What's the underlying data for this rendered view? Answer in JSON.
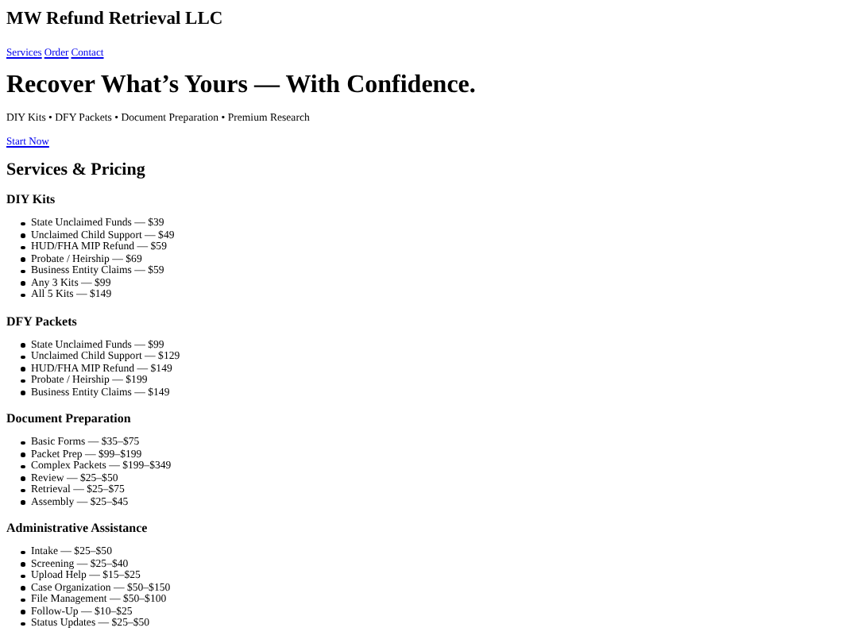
{
  "site_title": "MW Refund Retrieval LLC",
  "nav": [
    {
      "label": "Services"
    },
    {
      "label": "Order"
    },
    {
      "label": "Contact"
    }
  ],
  "hero": {
    "heading": "Recover What’s Yours — With Confidence.",
    "tagline": "DIY Kits • DFY Packets • Document Preparation • Premium Research",
    "cta": "Start Now"
  },
  "services": {
    "heading": "Services & Pricing",
    "sections": [
      {
        "title": "DIY Kits",
        "items": [
          "State Unclaimed Funds — $39",
          "Unclaimed Child Support — $49",
          "HUD/FHA MIP Refund — $59",
          "Probate / Heirship — $69",
          "Business Entity Claims — $59",
          "Any 3 Kits — $99",
          "All 5 Kits — $149"
        ]
      },
      {
        "title": "DFY Packets",
        "items": [
          "State Unclaimed Funds — $99",
          "Unclaimed Child Support — $129",
          "HUD/FHA MIP Refund — $149",
          "Probate / Heirship — $199",
          "Business Entity Claims — $149"
        ]
      },
      {
        "title": "Document Preparation",
        "items": [
          "Basic Forms — $35–$75",
          "Packet Prep — $99–$199",
          "Complex Packets — $199–$349",
          "Review — $25–$50",
          "Retrieval — $25–$75",
          "Assembly — $25–$45"
        ]
      },
      {
        "title": "Administrative Assistance",
        "items": [
          "Intake — $25–$50",
          "Screening — $25–$40",
          "Upload Help — $15–$25",
          "Case Organization — $50–$150",
          "File Management — $50–$100",
          "Follow-Up — $10–$25",
          "Status Updates — $25–$50"
        ]
      }
    ]
  }
}
